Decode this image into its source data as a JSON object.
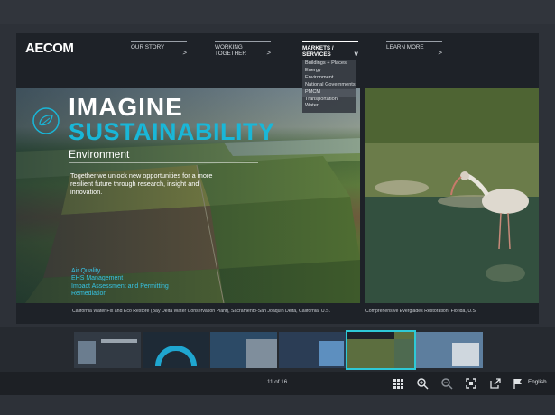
{
  "brand": {
    "logo": "AECOM"
  },
  "nav": [
    {
      "label": "OUR STORY",
      "chevron": ">"
    },
    {
      "label": "WORKING TOGETHER",
      "chevron": ">"
    },
    {
      "label": "MARKETS / SERVICES",
      "chevron": "v"
    },
    {
      "label": "LEARN MORE",
      "chevron": ">"
    }
  ],
  "dropdown": {
    "items": [
      "Buildings + Places",
      "Energy",
      "Environment",
      "National Governments",
      "PMCM",
      "Transportation",
      "Water"
    ],
    "selected": "PMCM"
  },
  "hero": {
    "title_1": "IMAGINE",
    "title_2": "SUSTAINABILITY",
    "subtitle": "Environment",
    "body": "Together we unlock new opportunities for a more resilient future through research, insight and innovation.",
    "links": [
      "Air Quality",
      "EHS Management",
      "Impact Assessment and Permitting",
      "Remediation"
    ]
  },
  "captions": {
    "left": "California Water Fix and Eco Restore (Bay Delta Water Conservation Plant), Sacramento-San Joaquin Delta, California, U.S.",
    "right": "Comprehensive Everglades Restoration, Florida, U.S."
  },
  "thumbnails": {
    "count": 6,
    "active_index": 4
  },
  "viewer": {
    "page_indicator": "11 of 16",
    "language": "English",
    "tools": [
      "grid-icon",
      "zoom-in-icon",
      "zoom-out-icon",
      "fullscreen-icon",
      "share-icon",
      "flag-icon"
    ]
  },
  "colors": {
    "accent": "#19b7d8",
    "thumb_active": "#2ec9d6"
  }
}
